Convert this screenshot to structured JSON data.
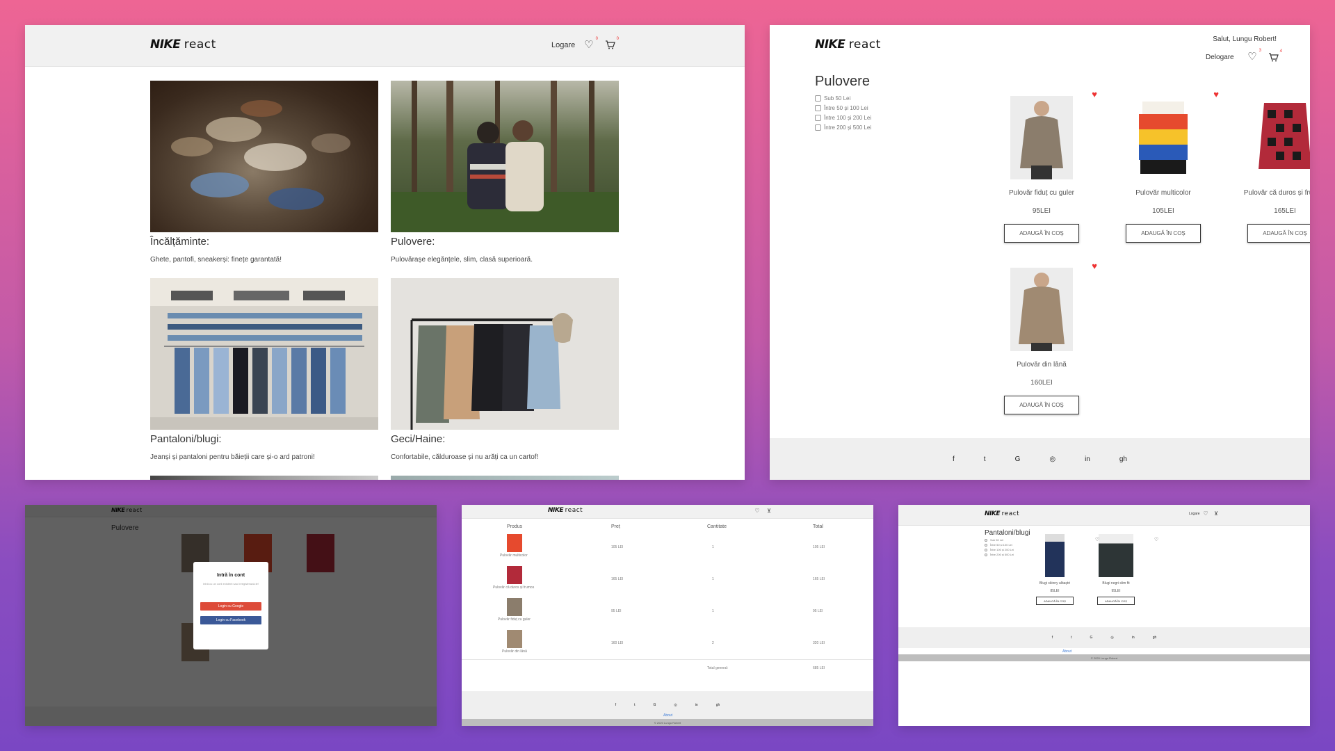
{
  "brand": {
    "logo_bold": "NIKE",
    "logo_light": "react"
  },
  "home": {
    "login_label": "Logare",
    "fav_count": "0",
    "cart_count": "0",
    "categories": [
      {
        "title": "Încălțăminte:",
        "desc": "Ghete, pantofi, sneakerși: finețe garantată!",
        "image": "shoes-photo"
      },
      {
        "title": "Pulovere:",
        "desc": "Pulovărașe elegănțele, slim, clasă superioară.",
        "image": "sweater-couple-photo"
      },
      {
        "title": "Pantaloni/blugi:",
        "desc": "Jeanși și pantaloni pentru băieții care și-o ard patroni!",
        "image": "jeans-store-photo"
      },
      {
        "title": "Geci/Haine:",
        "desc": "Confortabile, călduroase și nu arăți ca un cartof!",
        "image": "coats-rack-photo"
      }
    ]
  },
  "sweaters": {
    "greeting": "Salut, Lungu Robert!",
    "logout_label": "Delogare",
    "fav_count": "3",
    "cart_count": "4",
    "page_title": "Pulovere",
    "filters": [
      "Sub 50 Lei",
      "Între 50 și 100 Lei",
      "Între 100 și 200 Lei",
      "Între 200 și 500 Lei"
    ],
    "add_label": "ADAUGĂ ÎN COȘ",
    "products": [
      {
        "name": "Pulovăr fiduț cu guler",
        "price": "95LEI",
        "favorite": true,
        "color": "#8b7d6c"
      },
      {
        "name": "Pulovăr multicolor",
        "price": "105LEI",
        "favorite": true,
        "color": "#e64a2e"
      },
      {
        "name": "Pulovăr că duros și frumos",
        "price": "165LEI",
        "favorite": false,
        "color": "#b22a3a"
      },
      {
        "name": "Pulovăr din lână",
        "price": "160LEI",
        "favorite": true,
        "color": "#a08a72"
      }
    ]
  },
  "social": [
    "f",
    "t",
    "G",
    "◎",
    "in",
    "gh"
  ],
  "login_modal": {
    "title": "Intră în cont",
    "subtitle": "Intră cu un cont existent sau înregistrează-te!",
    "google_label": "Login cu Google",
    "facebook_label": "Login cu Facebook"
  },
  "cart": {
    "headers": [
      "Produs",
      "Preț",
      "Cantitate",
      "Total"
    ],
    "rows": [
      {
        "name": "Pulovăr multicolor",
        "price": "105 LEI",
        "qty": "1",
        "total": "105 LEI",
        "color": "#e64a2e"
      },
      {
        "name": "Pulovăr că duros și frumos",
        "price": "165 LEI",
        "qty": "1",
        "total": "165 LEI",
        "color": "#b22a3a"
      },
      {
        "name": "Pulovăr fiduț cu guler",
        "price": "95 LEI",
        "qty": "1",
        "total": "95 LEI",
        "color": "#8b7d6c"
      },
      {
        "name": "Pulovăr din lână",
        "price": "160 LEI",
        "qty": "2",
        "total": "320 LEI",
        "color": "#a08a72"
      }
    ],
    "total_label": "Total general:",
    "total_value": "685 LEI",
    "about": "About",
    "copyright": "© 2020 Lungu Robert"
  },
  "jeans": {
    "page_title": "Pantaloni/blugi",
    "login_label": "Logare",
    "filters": [
      "Sub 50 Lei",
      "Între 50 și 100 Lei",
      "Între 100 și 200 Lei",
      "Între 200 și 500 Lei"
    ],
    "products": [
      {
        "name": "Blugi skinny albaștri",
        "price": "85LEI",
        "color": "#22335a"
      },
      {
        "name": "Blugi negri slim fit",
        "price": "95LEI",
        "color": "#2d3536"
      }
    ],
    "add_label": "ADAUGĂ ÎN COȘ",
    "about": "About",
    "copyright": "© 2020 Lungu Robert"
  }
}
